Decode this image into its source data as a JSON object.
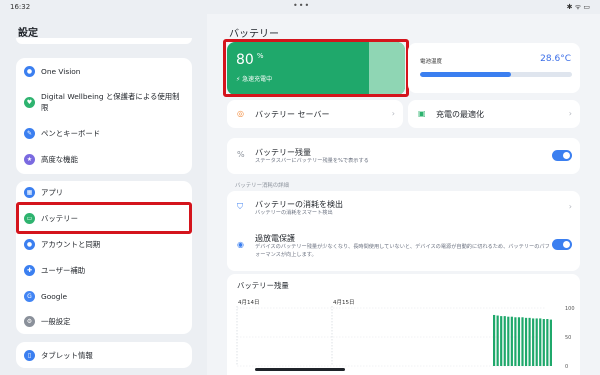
{
  "status_bar": {
    "time": "16:32",
    "right_icons": "✱ ᯤ ▭"
  },
  "sidebar": {
    "title": "設定",
    "group1": [
      {
        "label": "One Vision",
        "icon": "one-vision-icon",
        "color": "#3b7ff0"
      },
      {
        "label": "Digital Wellbeing と保護者による使用制限",
        "icon": "wellbeing-icon",
        "color": "#2eb36f"
      },
      {
        "label": "ペンとキーボード",
        "icon": "pen-icon",
        "color": "#3b7ff0"
      },
      {
        "label": "高度な機能",
        "icon": "star-icon",
        "color": "#7a6ae0"
      }
    ],
    "group2": [
      {
        "label": "アプリ",
        "icon": "apps-icon",
        "color": "#3b7ff0"
      },
      {
        "label": "バッテリー",
        "icon": "battery-icon",
        "color": "#2eb36f",
        "selected": true
      },
      {
        "label": "アカウントと同期",
        "icon": "account-icon",
        "color": "#3b7ff0"
      },
      {
        "label": "ユーザー補助",
        "icon": "accessibility-icon",
        "color": "#3b7ff0"
      },
      {
        "label": "Google",
        "icon": "google-icon",
        "color": "#4285f4"
      },
      {
        "label": "一般設定",
        "icon": "gear-icon",
        "color": "#8a909a"
      }
    ],
    "group3": [
      {
        "label": "タブレット情報",
        "icon": "tablet-icon",
        "color": "#3b7ff0"
      }
    ]
  },
  "main": {
    "title": "バッテリー",
    "battery": {
      "percent": "80",
      "unit": "%",
      "status": "⚡ 急速充電中",
      "level": 0.8
    },
    "temperature": {
      "label": "電池温度",
      "value": "28.6°C",
      "level": 0.6
    },
    "saver": {
      "label": "バッテリー セーバー"
    },
    "optimize": {
      "label": "充電の最適化"
    },
    "battery_percent_row": {
      "label": "バッテリー残量",
      "sub": "ステータスバーにバッテリー残量を%で表示する",
      "enabled": true
    },
    "section_caption": "バッテリー消耗の詳細",
    "drain_detect": {
      "label": "バッテリーの消耗を検出",
      "sub": "バッテリーの消耗をスマート検出"
    },
    "overcharge": {
      "label": "過放電保護",
      "sub": "デバイスのバッテリー残量が少なくなり、長時間使用していないと、デバイスの電源が自動的に切れるため、バッテリーのパフォーマンスが向上します。",
      "enabled": true
    },
    "chart_title": "バッテリー残量"
  },
  "chart_data": {
    "type": "bar",
    "title": "バッテリー残量",
    "x_tick_labels": [
      "4月14日",
      "4月15日"
    ],
    "y_tick_labels": [
      "100",
      "50",
      "0"
    ],
    "ylim": [
      0,
      100
    ],
    "values": [
      88,
      87,
      86,
      86,
      85,
      85,
      84,
      84,
      84,
      83,
      83,
      82,
      82,
      82,
      81,
      81,
      80
    ],
    "bar_color": "#1fa86b"
  }
}
